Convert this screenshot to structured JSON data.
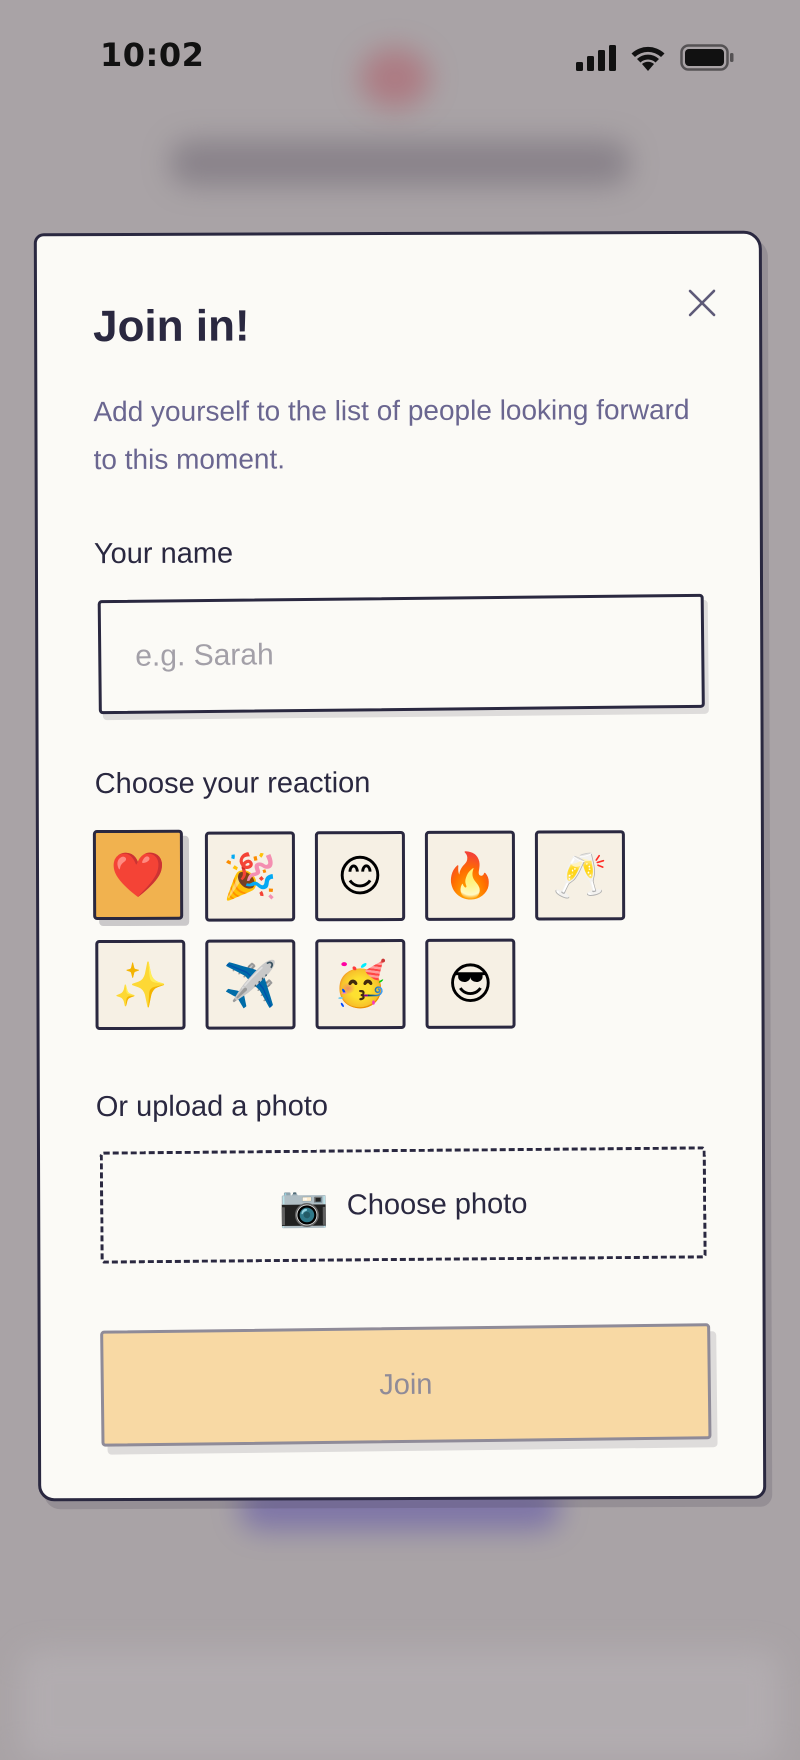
{
  "status_bar": {
    "time": "10:02",
    "icons": [
      "signal-icon",
      "wifi-icon",
      "battery-icon"
    ]
  },
  "modal": {
    "title": "Join in!",
    "description": "Add yourself to the list of people looking forward to this moment.",
    "name_label": "Your name",
    "name_placeholder": "e.g. Sarah",
    "name_value": "",
    "reaction_label": "Choose your reaction",
    "reactions": [
      {
        "emoji": "❤️",
        "name": "heart",
        "selected": true
      },
      {
        "emoji": "🎉",
        "name": "party-popper",
        "selected": false
      },
      {
        "emoji": "😊",
        "name": "smiling-face",
        "selected": false
      },
      {
        "emoji": "🔥",
        "name": "fire",
        "selected": false
      },
      {
        "emoji": "🥂",
        "name": "clinking-glasses",
        "selected": false
      },
      {
        "emoji": "✨",
        "name": "sparkles",
        "selected": false
      },
      {
        "emoji": "✈️",
        "name": "airplane",
        "selected": false
      },
      {
        "emoji": "🥳",
        "name": "partying-face",
        "selected": false
      },
      {
        "emoji": "😎",
        "name": "sunglasses-face",
        "selected": false
      }
    ],
    "photo_label": "Or upload a photo",
    "choose_photo_label": "Choose photo",
    "camera_icon": "📷",
    "join_label": "Join",
    "close_icon": "close-icon"
  },
  "colors": {
    "ink": "#2a2840",
    "muted_text": "#6a6690",
    "selected_reaction": "#f1b24f",
    "join_button": "#f8d9a4",
    "modal_bg": "#fbfaf6",
    "backdrop": "#a9a3a6"
  }
}
